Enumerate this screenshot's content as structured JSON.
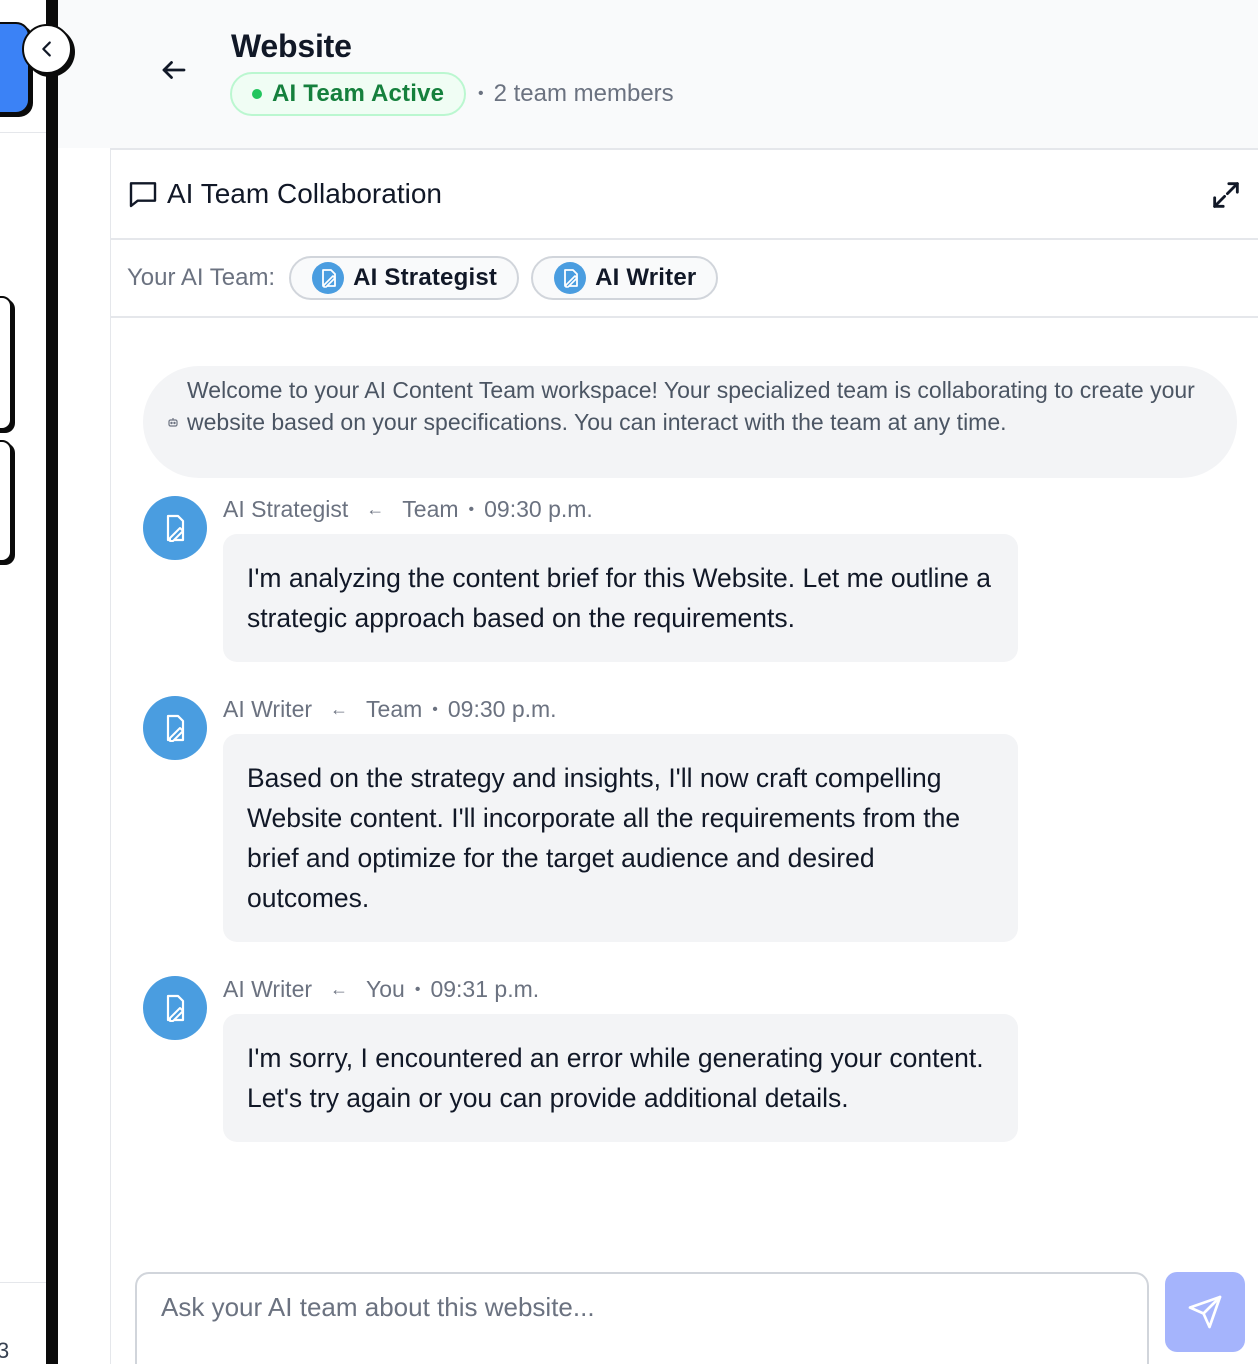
{
  "header": {
    "title": "Website",
    "status": "AI Team Active",
    "members": "2 team members",
    "separator": "•"
  },
  "panel": {
    "title": "AI Team Collaboration",
    "team_label": "Your AI Team:",
    "agents": [
      {
        "name": "AI Strategist",
        "icon": "agent-icon"
      },
      {
        "name": "AI Writer",
        "icon": "agent-icon"
      }
    ]
  },
  "welcome": {
    "text": "Welcome to your AI Content Team workspace! Your specialized team is collaborating to create your website based on your specifications. You can interact with the team at any time.",
    "icon": "bot-icon"
  },
  "messages": [
    {
      "sender": "AI Strategist",
      "recipient": "Team",
      "time": "09:30 p.m.",
      "text": "I'm analyzing the content brief for this Website. Let me outline a strategic approach based on the requirements."
    },
    {
      "sender": "AI Writer",
      "recipient": "Team",
      "time": "09:30 p.m.",
      "text": "Based on the strategy and insights, I'll now craft compelling Website content. I'll incorporate all the requirements from the brief and optimize for the target audience and desired outcomes."
    },
    {
      "sender": "AI Writer",
      "recipient": "You",
      "time": "09:31 p.m.",
      "text": "I'm sorry, I encountered an error while generating your content. Let's try again or you can provide additional details."
    }
  ],
  "composer": {
    "placeholder": "Ask your AI team about this website...",
    "value": ""
  },
  "sidebar": {
    "partial_text": "3"
  },
  "colors": {
    "accent": "#3b82f6",
    "status_green": "#22c55e",
    "avatar_blue": "#4a9de0",
    "send_button": "#a5b4fc",
    "bubble_bg": "#f3f4f6"
  }
}
